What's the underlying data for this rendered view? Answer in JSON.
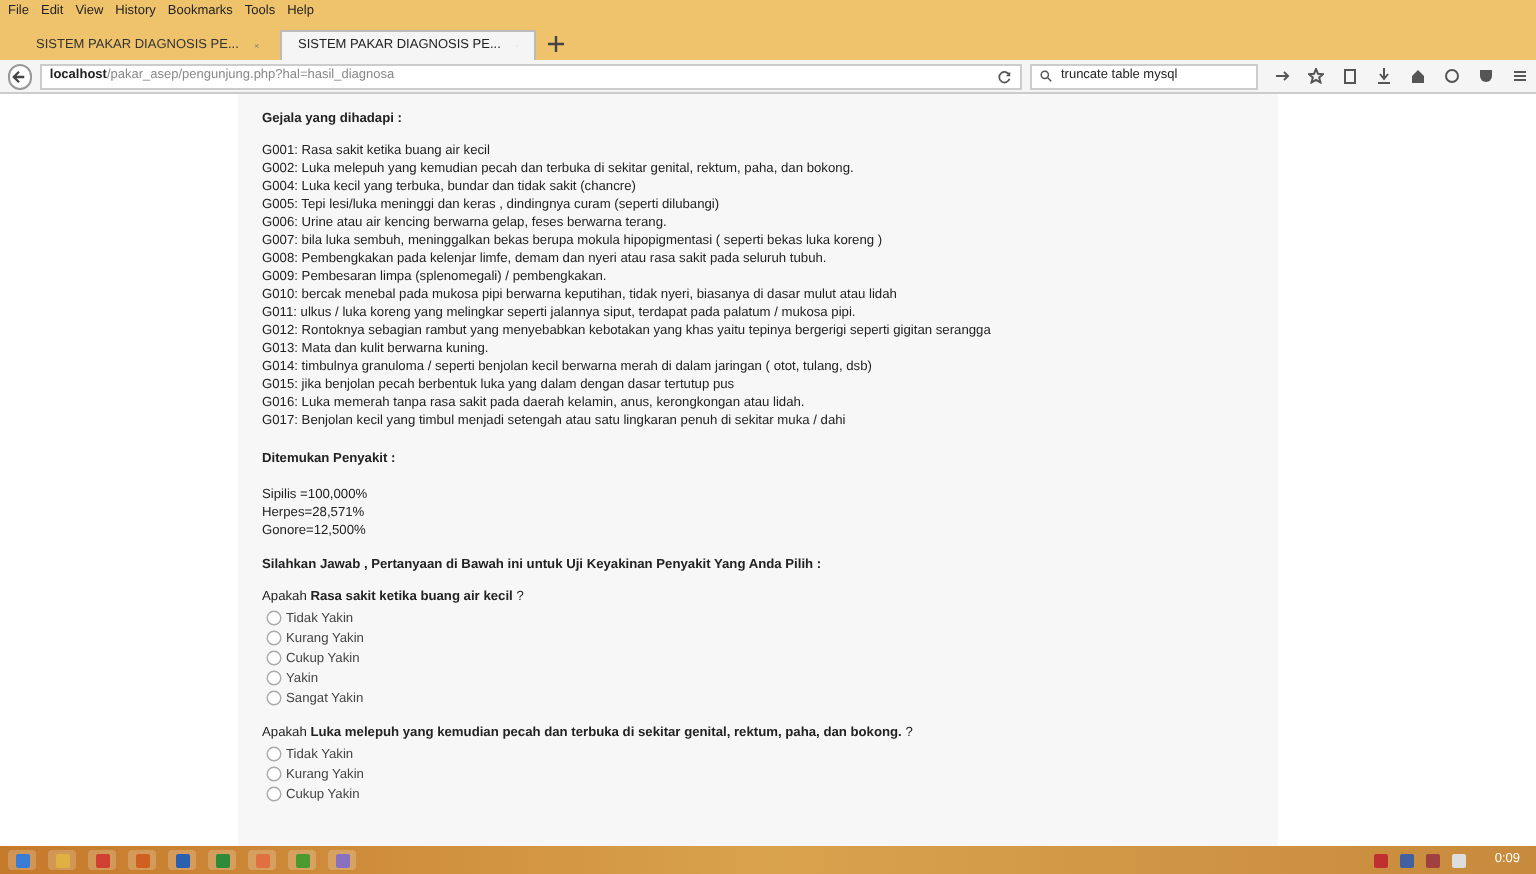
{
  "menu": [
    "File",
    "Edit",
    "View",
    "History",
    "Bookmarks",
    "Tools",
    "Help"
  ],
  "tabs": [
    {
      "label": "SISTEM PAKAR DIAGNOSIS PE...",
      "selected": false
    },
    {
      "label": "SISTEM PAKAR DIAGNOSIS PE...",
      "selected": true
    }
  ],
  "address_bar": {
    "host": "localhost",
    "path": "/pakar_asep/pengunjung.php?hal=hasil_diagnosa"
  },
  "search": {
    "value": "truncate table mysql"
  },
  "page": {
    "symptoms_heading": "Gejala yang dihadapi :",
    "symptoms": [
      "G001: Rasa sakit ketika buang air kecil",
      "G002: Luka melepuh yang kemudian pecah dan terbuka di sekitar genital, rektum, paha, dan bokong.",
      "G004: Luka kecil yang terbuka, bundar dan tidak sakit  (chancre)",
      "G005: Tepi lesi/luka meninggi dan keras , dindingnya curam (seperti dilubangi)",
      "G006: Urine atau air kencing berwarna gelap, feses berwarna terang.",
      "G007: bila luka sembuh, meninggalkan bekas berupa mokula hipopigmentasi ( seperti bekas luka koreng )",
      "G008: Pembengkakan pada kelenjar limfe, demam dan nyeri atau rasa sakit pada seluruh tubuh.",
      "G009: Pembesaran limpa (splenomegali) / pembengkakan.",
      "G010: bercak menebal pada mukosa pipi berwarna keputihan, tidak nyeri, biasanya di dasar mulut atau lidah",
      "G011: ulkus / luka koreng yang melingkar seperti jalannya siput, terdapat pada palatum / mukosa pipi.",
      "G012: Rontoknya sebagian rambut yang menyebabkan kebotakan yang khas yaitu tepinya bergerigi seperti gigitan serangga",
      "G013: Mata dan kulit berwarna kuning.",
      "G014: timbulnya granuloma / seperti benjolan kecil berwarna merah di dalam jaringan ( otot, tulang, dsb)",
      "G015: jika benjolan pecah berbentuk luka yang dalam dengan dasar tertutup pus",
      "G016: Luka memerah tanpa rasa sakit pada daerah kelamin, anus, kerongkongan atau lidah.",
      "G017: Benjolan kecil yang timbul menjadi setengah atau satu lingkaran penuh di sekitar muka / dahi"
    ],
    "diseases_heading": "Ditemukan Penyakit :",
    "diseases": [
      "Sipilis =100,000%",
      "Herpes=28,571%",
      "Gonore=12,500%"
    ],
    "questions_heading": "Silahkan Jawab , Pertanyaan di Bawah ini untuk Uji Keyakinan Penyakit Yang Anda Pilih :",
    "questions": [
      {
        "text": "Apakah **Rasa sakit ketika buang air kecil** ?",
        "options": [
          {
            "label": "Tidak Yakin",
            "selected": false
          },
          {
            "label": "Kurang Yakin",
            "selected": false
          },
          {
            "label": "Cukup Yakin",
            "selected": false
          },
          {
            "label": "Yakin",
            "selected": false
          },
          {
            "label": "Sangat Yakin",
            "selected": false
          }
        ]
      },
      {
        "text": "Apakah **Luka melepuh yang kemudian pecah dan terbuka di sekitar genital, rektum, paha, dan bokong.** ?",
        "options": [
          {
            "label": "Tidak Yakin",
            "selected": false
          },
          {
            "label": "Kurang Yakin",
            "selected": false
          },
          {
            "label": "Cukup Yakin",
            "selected": false
          }
        ]
      }
    ]
  },
  "taskbar": {
    "clock": "0:09"
  }
}
